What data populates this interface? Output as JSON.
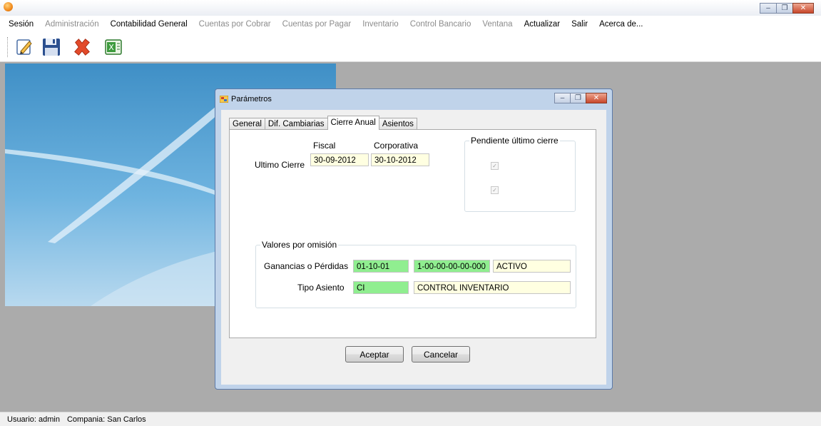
{
  "window": {
    "title": "",
    "controls": {
      "minimize": "–",
      "restore": "❐",
      "close": "✕"
    }
  },
  "menu": [
    {
      "label": "Sesión",
      "enabled": true
    },
    {
      "label": "Administración",
      "enabled": false
    },
    {
      "label": "Contabilidad General",
      "enabled": true
    },
    {
      "label": "Cuentas por Cobrar",
      "enabled": false
    },
    {
      "label": "Cuentas por Pagar",
      "enabled": false
    },
    {
      "label": "Inventario",
      "enabled": false
    },
    {
      "label": "Control Bancario",
      "enabled": false
    },
    {
      "label": "Ventana",
      "enabled": false
    },
    {
      "label": "Actualizar",
      "enabled": true
    },
    {
      "label": "Salir",
      "enabled": true
    },
    {
      "label": "Acerca de...",
      "enabled": true
    }
  ],
  "toolbar": {
    "buttons": [
      "edit-icon",
      "save-icon",
      "delete-icon",
      "excel-icon"
    ],
    "excel_text": "X"
  },
  "dialog": {
    "title": "Parámetros",
    "tabs": [
      {
        "label": "General",
        "active": false
      },
      {
        "label": "Dif. Cambiarias",
        "active": false
      },
      {
        "label": "Cierre Anual",
        "active": true
      },
      {
        "label": "Asientos",
        "active": false
      }
    ],
    "cierre": {
      "fiscal_header": "Fiscal",
      "corporativa_header": "Corporativa",
      "ultimo_cierre_label": "Ultimo Cierre",
      "fiscal_value": "30-09-2012",
      "corporativa_value": "30-10-2012",
      "pendiente_title": "Pendiente último cierre",
      "pendiente_fiscal_checked": true,
      "pendiente_corporativa_checked": true,
      "check_glyph": "✓"
    },
    "valores": {
      "title": "Valores por omisión",
      "ganancias_label": "Ganancias o Pérdidas",
      "ganancias_code": "01-10-01",
      "ganancias_account": "1-00-00-00-00-000",
      "ganancias_desc": "ACTIVO",
      "tipo_label": "Tipo Asiento",
      "tipo_code": "CI",
      "tipo_desc": "CONTROL INVENTARIO"
    },
    "buttons": {
      "accept": "Aceptar",
      "cancel": "Cancelar"
    }
  },
  "status": {
    "user": "Usuario: admin",
    "company": "Compania: San Carlos"
  },
  "colors": {
    "mdi_background": "#ababab",
    "readonly_field": "#ffffe1",
    "lookup_field": "#90ee90"
  }
}
